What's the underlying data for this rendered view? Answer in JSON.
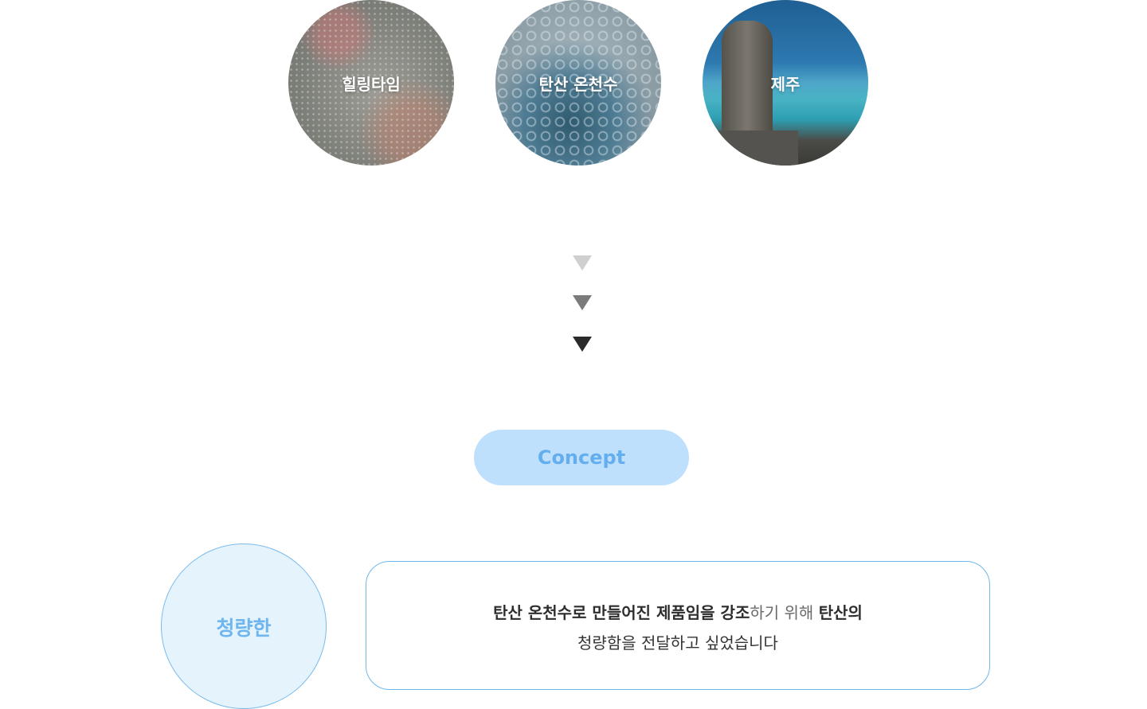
{
  "theme_circles": [
    {
      "label": "힐링타임"
    },
    {
      "label": "탄산 온천수"
    },
    {
      "label": "제주"
    }
  ],
  "concept": {
    "label": "Concept"
  },
  "keyword": {
    "label": "청량한"
  },
  "description": {
    "line1_bold_a": "탄산 온천수로 만들어진 제품임을 강조",
    "line1_light": "하기 위해 ",
    "line1_bold_b": "탄산의",
    "line2": "청량함을 전달하고 싶었습니다"
  },
  "colors": {
    "accent": "#bfe0fd",
    "accent_text": "#63aeee",
    "border": "#6fb8ec",
    "arrow_light": "#cfcfcf",
    "arrow_mid": "#7b7b7b",
    "arrow_dark": "#2a2a2a"
  }
}
